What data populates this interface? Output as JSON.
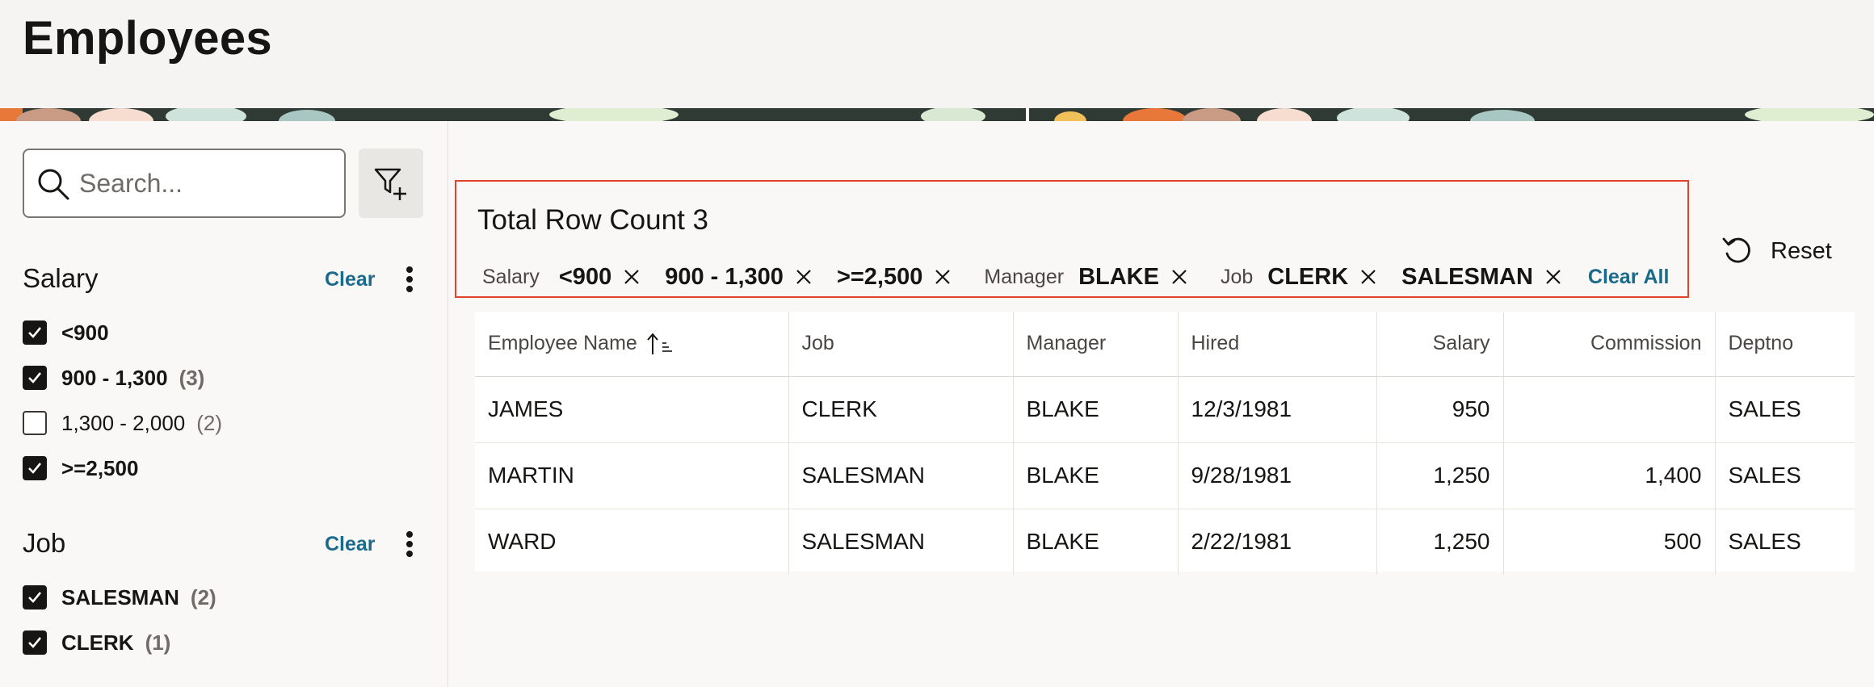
{
  "header": {
    "title": "Employees"
  },
  "search": {
    "placeholder": "Search..."
  },
  "facets": {
    "salary": {
      "title": "Salary",
      "clear_label": "Clear",
      "items": [
        {
          "label": "<900",
          "count": "",
          "checked": true
        },
        {
          "label": "900 - 1,300",
          "count": "(3)",
          "checked": true
        },
        {
          "label": "1,300 - 2,000",
          "count": "(2)",
          "checked": false
        },
        {
          "label": ">=2,500",
          "count": "",
          "checked": true
        }
      ]
    },
    "job": {
      "title": "Job",
      "clear_label": "Clear",
      "items": [
        {
          "label": "SALESMAN",
          "count": "(2)",
          "checked": true
        },
        {
          "label": "CLERK",
          "count": "(1)",
          "checked": true
        }
      ]
    }
  },
  "summary": {
    "row_count": "Total Row Count 3",
    "groups": [
      {
        "category": "Salary",
        "values": [
          "<900",
          "900 - 1,300",
          ">=2,500"
        ]
      },
      {
        "category": "Manager",
        "values": [
          "BLAKE"
        ]
      },
      {
        "category": "Job",
        "values": [
          "CLERK",
          "SALESMAN"
        ]
      }
    ],
    "clear_all_label": "Clear All"
  },
  "reset_label": "Reset",
  "table": {
    "columns": [
      "Employee Name",
      "Job",
      "Manager",
      "Hired",
      "Salary",
      "Commission",
      "Deptno"
    ],
    "rows": [
      [
        "JAMES",
        "CLERK",
        "BLAKE",
        "12/3/1981",
        "950",
        "",
        "SALES"
      ],
      [
        "MARTIN",
        "SALESMAN",
        "BLAKE",
        "9/28/1981",
        "1,250",
        "1,400",
        "SALES"
      ],
      [
        "WARD",
        "SALESMAN",
        "BLAKE",
        "2/22/1981",
        "1,250",
        "500",
        "SALES"
      ]
    ]
  },
  "colors": {
    "accent_link": "#1a6a8c",
    "highlight_border": "#e0422c",
    "text": "#161513"
  }
}
